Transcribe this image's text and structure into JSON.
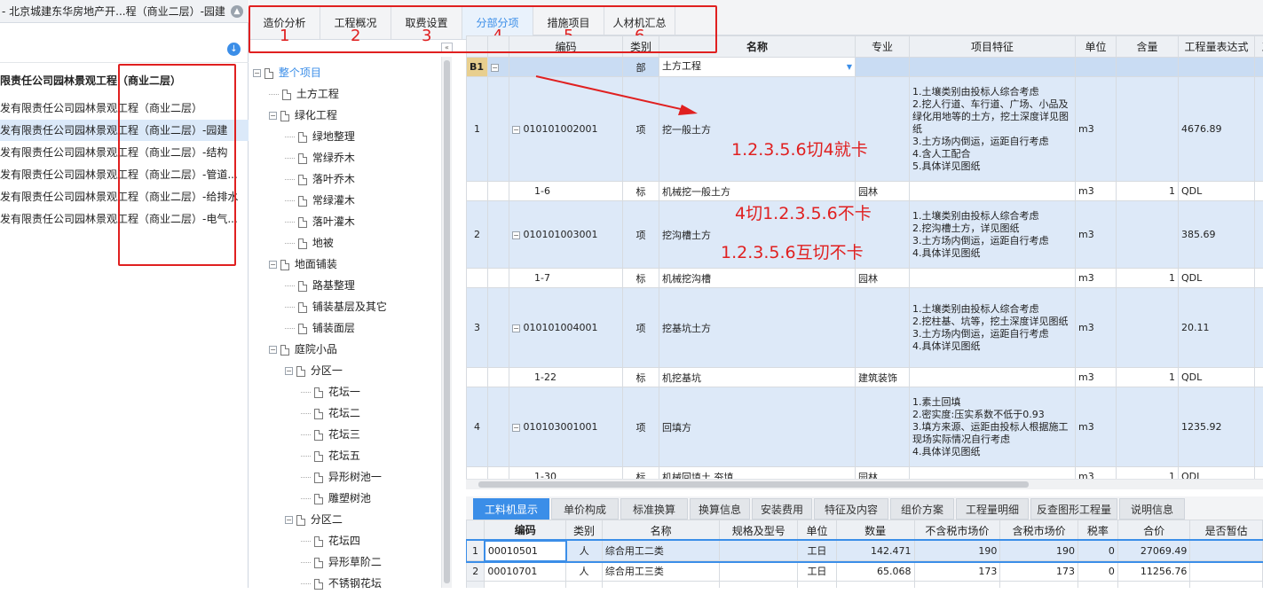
{
  "left": {
    "title": "- 北京城建东华房地产开...程（商业二层）-园建",
    "projects": [
      "限责任公司园林景观工程（商业二层）",
      "发有限责任公司园林景观工程（商业二层）",
      "发有限责任公司园林景观工程（商业二层）-园建",
      "发有限责任公司园林景观工程（商业二层）-结构",
      "发有限责任公司园林景观工程（商业二层）-管道...",
      "发有限责任公司园林景观工程（商业二层）-给排水",
      "发有限责任公司园林景观工程（商业二层）-电气..."
    ]
  },
  "tabs": [
    {
      "label": "造价分析",
      "num": "1"
    },
    {
      "label": "工程概况",
      "num": "2"
    },
    {
      "label": "取费设置",
      "num": "3"
    },
    {
      "label": "分部分项",
      "num": "4"
    },
    {
      "label": "措施项目",
      "num": "5"
    },
    {
      "label": "人材机汇总",
      "num": "6"
    }
  ],
  "tree": [
    {
      "t": "整个项目",
      "lv": 0,
      "box": "−"
    },
    {
      "t": "土方工程",
      "lv": 1,
      "box": ""
    },
    {
      "t": "绿化工程",
      "lv": 1,
      "box": "−"
    },
    {
      "t": "绿地整理",
      "lv": 2,
      "box": ""
    },
    {
      "t": "常绿乔木",
      "lv": 2,
      "box": ""
    },
    {
      "t": "落叶乔木",
      "lv": 2,
      "box": ""
    },
    {
      "t": "常绿灌木",
      "lv": 2,
      "box": ""
    },
    {
      "t": "落叶灌木",
      "lv": 2,
      "box": ""
    },
    {
      "t": "地被",
      "lv": 2,
      "box": ""
    },
    {
      "t": "地面铺装",
      "lv": 1,
      "box": "−"
    },
    {
      "t": "路基整理",
      "lv": 2,
      "box": ""
    },
    {
      "t": "铺装基层及其它",
      "lv": 2,
      "box": ""
    },
    {
      "t": "铺装面层",
      "lv": 2,
      "box": ""
    },
    {
      "t": "庭院小品",
      "lv": 1,
      "box": "−"
    },
    {
      "t": "分区一",
      "lv": 2,
      "box": "−"
    },
    {
      "t": "花坛一",
      "lv": 3,
      "box": ""
    },
    {
      "t": "花坛二",
      "lv": 3,
      "box": ""
    },
    {
      "t": "花坛三",
      "lv": 3,
      "box": ""
    },
    {
      "t": "花坛五",
      "lv": 3,
      "box": ""
    },
    {
      "t": "异形树池一",
      "lv": 3,
      "box": ""
    },
    {
      "t": "雕塑树池",
      "lv": 3,
      "box": ""
    },
    {
      "t": "分区二",
      "lv": 2,
      "box": "−"
    },
    {
      "t": "花坛四",
      "lv": 3,
      "box": ""
    },
    {
      "t": "异形草阶二",
      "lv": 3,
      "box": ""
    },
    {
      "t": "不锈钢花坛",
      "lv": 3,
      "box": ""
    }
  ],
  "grid": {
    "headers": [
      "编码",
      "类别",
      "名称",
      "专业",
      "项目特征",
      "单位",
      "含量",
      "工程量表达式",
      "工程量"
    ],
    "b1": {
      "row": "B1",
      "type": "部",
      "name": "土方工程"
    },
    "rows": [
      {
        "no": "1",
        "code": "010101002001",
        "type": "项",
        "name": "挖一般土方",
        "major": "",
        "feat": "1.土壤类别由投标人综合考虑\n2.挖人行道、车行道、广场、小品及绿化用地等的土方，挖土深度详见图纸\n3.土方场内倒运，运距自行考虑\n4.含人工配合\n5.具体详见图纸",
        "unit": "m3",
        "qty": "",
        "expr": "4676.89",
        "amt": "467",
        "h": 118,
        "q": true
      },
      {
        "no": "",
        "code": "1-6",
        "type": "标",
        "name": "机械挖一般土方",
        "major": "园林",
        "feat": "",
        "unit": "m3",
        "qty": "1",
        "expr": "QDL",
        "amt": "467",
        "h": 22,
        "q": false
      },
      {
        "no": "2",
        "code": "010101003001",
        "type": "项",
        "name": "挖沟槽土方",
        "major": "",
        "feat": "1.土壤类别由投标人综合考虑\n2.挖沟槽土方，详见图纸\n3.土方场内倒运，运距自行考虑\n4.具体详见图纸",
        "unit": "m3",
        "qty": "",
        "expr": "385.69",
        "amt": "38",
        "h": 76,
        "q": true
      },
      {
        "no": "",
        "code": "1-7",
        "type": "标",
        "name": "机械挖沟槽",
        "major": "园林",
        "feat": "",
        "unit": "m3",
        "qty": "1",
        "expr": "QDL",
        "amt": "38",
        "h": 22,
        "q": false
      },
      {
        "no": "3",
        "code": "010101004001",
        "type": "项",
        "name": "挖基坑土方",
        "major": "",
        "feat": "1.土壤类别由投标人综合考虑\n2.挖柱基、坑等，挖土深度详见图纸\n3.土方场内倒运，运距自行考虑\n4.具体详见图纸",
        "unit": "m3",
        "qty": "",
        "expr": "20.11",
        "amt": "2",
        "h": 90,
        "q": true
      },
      {
        "no": "",
        "code": "1-22",
        "type": "标",
        "name": "机挖基坑",
        "major": "建筑装饰",
        "feat": "",
        "unit": "m3",
        "qty": "1",
        "expr": "QDL",
        "amt": "2",
        "h": 22,
        "q": false
      },
      {
        "no": "4",
        "code": "010103001001",
        "type": "项",
        "name": "回填方",
        "major": "",
        "feat": "1.素土回填\n2.密实度:压实系数不低于0.93\n3.填方来源、运距由投标人根据施工现场实际情况自行考虑\n4.具体详见图纸",
        "unit": "m3",
        "qty": "",
        "expr": "1235.92",
        "amt": "123",
        "h": 90,
        "q": true
      },
      {
        "no": "",
        "code": "1-30",
        "type": "标",
        "name": "机械回填土 夯填",
        "major": "园林",
        "feat": "",
        "unit": "m3",
        "qty": "1",
        "expr": "QDL",
        "amt": "123",
        "h": 22,
        "q": false
      }
    ]
  },
  "btabs": [
    "工料机显示",
    "单价构成",
    "标准换算",
    "换算信息",
    "安装费用",
    "特征及内容",
    "组价方案",
    "工程量明细",
    "反查图形工程量",
    "说明信息"
  ],
  "bgrid": {
    "headers": [
      "编码",
      "类别",
      "名称",
      "规格及型号",
      "单位",
      "数量",
      "不含税市场价",
      "含税市场价",
      "税率",
      "合价",
      "是否暂估"
    ],
    "rows": [
      [
        "1",
        "00010501",
        "人",
        "综合用工二类",
        "",
        "工日",
        "142.471",
        "190",
        "190",
        "0",
        "27069.49",
        ""
      ],
      [
        "2",
        "00010701",
        "人",
        "综合用工三类",
        "",
        "工日",
        "65.068",
        "173",
        "173",
        "0",
        "11256.76",
        ""
      ],
      [
        "3",
        "",
        "",
        "",
        "",
        "",
        "",
        "",
        "",
        "",
        "",
        ""
      ]
    ]
  },
  "annotations": {
    "a1": "1.2.3.5.6切4就卡",
    "a2": "4切1.2.3.5.6不卡",
    "a3": "1.2.3.5.6互切不卡"
  }
}
